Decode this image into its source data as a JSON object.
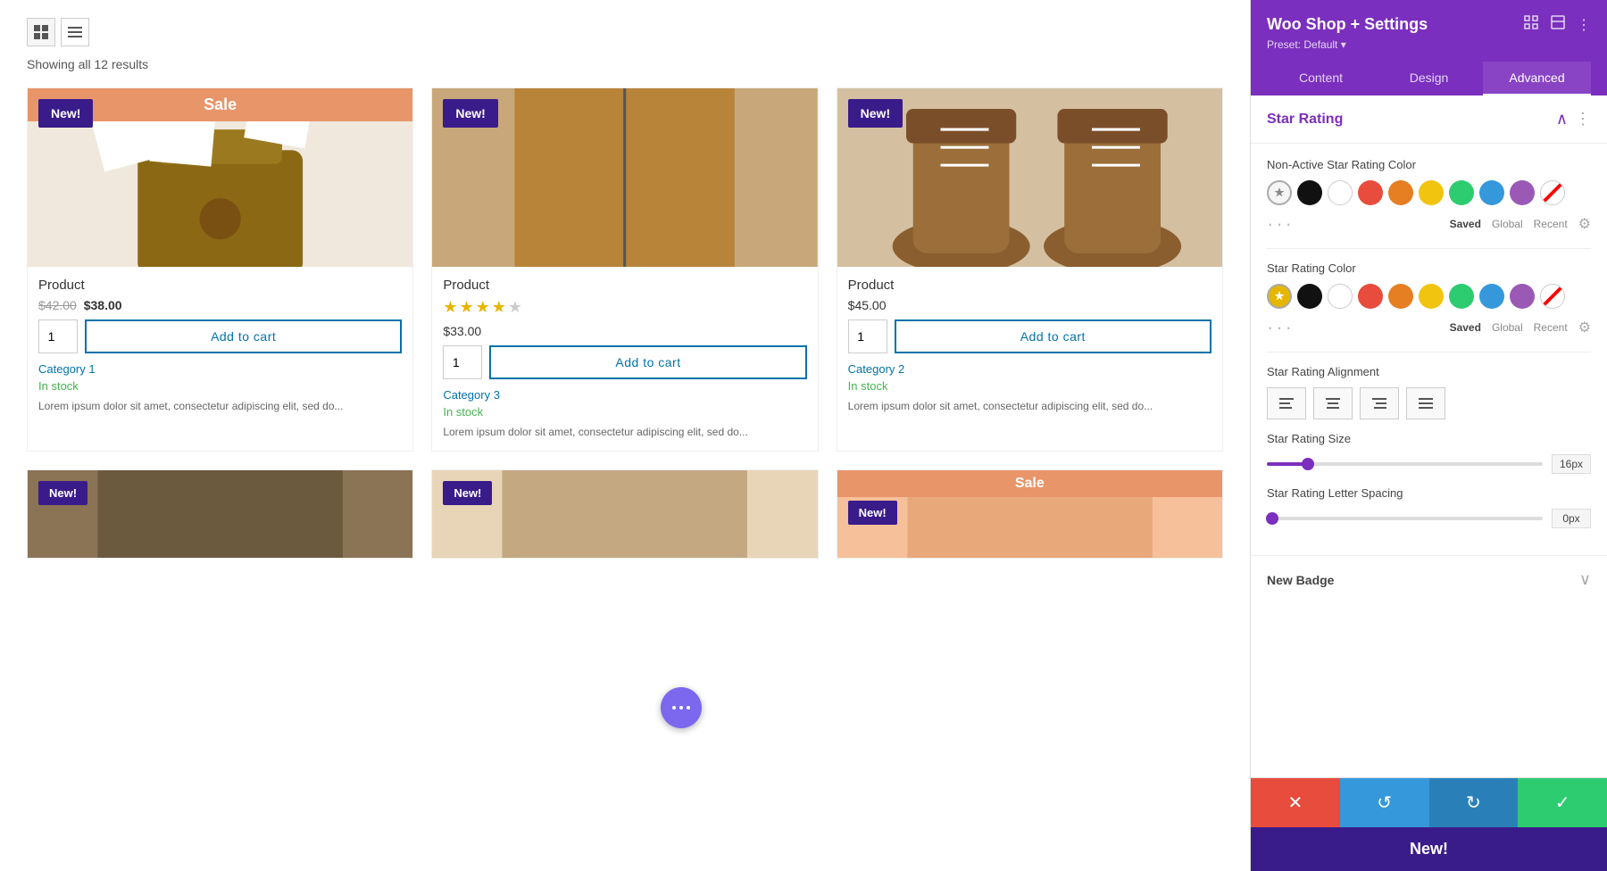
{
  "panel": {
    "title": "Woo Shop + Settings",
    "preset": "Preset: Default ▾",
    "tabs": [
      "Content",
      "Design",
      "Advanced"
    ],
    "active_tab": "Advanced"
  },
  "star_rating_section": {
    "title": "Star Rating",
    "non_active_label": "Non-Active Star Rating Color",
    "active_label": "Star Rating Color",
    "alignment_label": "Star Rating Alignment",
    "size_label": "Star Rating Size",
    "size_value": "16px",
    "letter_spacing_label": "Star Rating Letter Spacing",
    "letter_spacing_value": "0px",
    "slider_fill_pct": 15,
    "slider2_fill_pct": 2
  },
  "new_badge_section": {
    "title": "New Badge"
  },
  "shop": {
    "results_count": "Showing all 12 results",
    "products": [
      {
        "id": 1,
        "label": "Sale",
        "badge": "New!",
        "title": "Product",
        "price_original": "$42.00",
        "price_sale": "$38.00",
        "has_stars": false,
        "qty": 1,
        "add_to_cart": "Add to cart",
        "category": "Category 1",
        "in_stock": "In stock",
        "excerpt": "Lorem ipsum dolor sit amet, consectetur adipiscing elit, sed do..."
      },
      {
        "id": 2,
        "label": "",
        "badge": "New!",
        "title": "Product",
        "price": "$33.00",
        "stars": 4,
        "max_stars": 5,
        "qty": 1,
        "add_to_cart": "Add to cart",
        "category": "Category 3",
        "in_stock": "In stock",
        "excerpt": "Lorem ipsum dolor sit amet, consectetur adipiscing elit, sed do..."
      },
      {
        "id": 3,
        "label": "",
        "badge": "New!",
        "title": "Product",
        "price": "$45.00",
        "has_stars": false,
        "qty": 1,
        "add_to_cart": "Add to cart",
        "category": "Category 2",
        "in_stock": "In stock",
        "excerpt": "Lorem ipsum dolor sit amet, consectetur adipiscing elit, sed do..."
      }
    ]
  },
  "footer": {
    "cancel_icon": "✕",
    "undo_icon": "↺",
    "redo_icon": "↻",
    "save_icon": "✓"
  },
  "color_options": {
    "saved": "Saved",
    "global": "Global",
    "recent": "Recent"
  },
  "floating_dots": "•••"
}
